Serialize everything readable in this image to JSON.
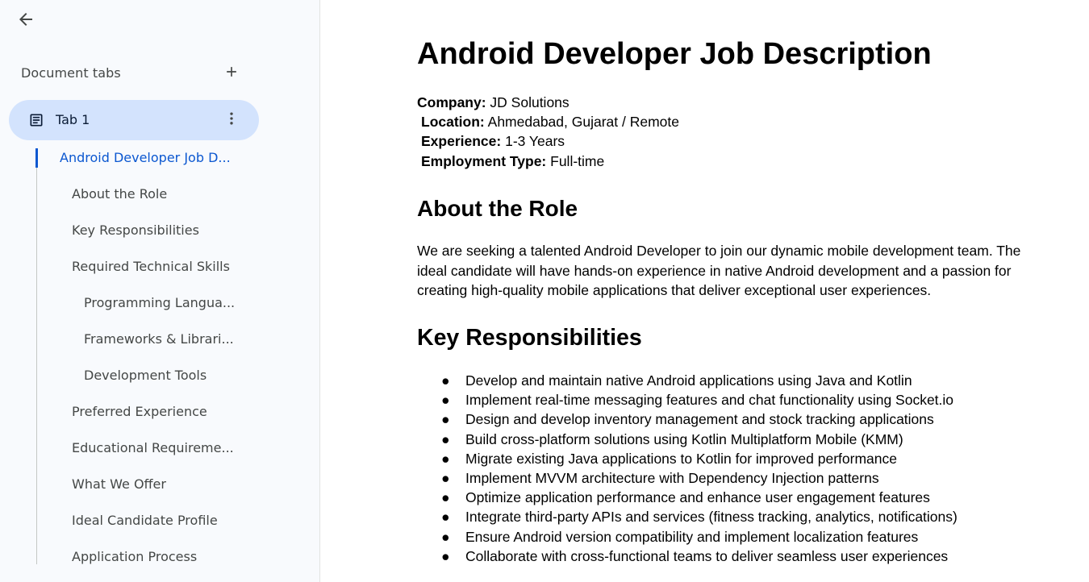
{
  "sidebar": {
    "back_icon": "arrow-left-icon",
    "tabs_title": "Document tabs",
    "add_icon": "plus-icon",
    "active_tab": {
      "label": "Tab 1",
      "icon": "document-icon",
      "more_icon": "more-vertical-icon"
    },
    "outline": [
      "Android Developer Job D...",
      "About the Role",
      "Key Responsibilities",
      "Required Technical Skills",
      "Programming Langua...",
      "Frameworks & Librari...",
      "Development Tools",
      "Preferred Experience",
      "Educational Requireme...",
      "What We Offer",
      "Ideal Candidate Profile",
      "Application Process"
    ],
    "accent_color": "#0b57d0",
    "pill_color": "#d3e3fd"
  },
  "document": {
    "title": "Android Developer Job Description",
    "meta": [
      {
        "key": "Company:",
        "value": " JD Solutions"
      },
      {
        "key": "Location:",
        "value": " Ahmedabad, Gujarat / Remote"
      },
      {
        "key": "Experience:",
        "value": " 1-3 Years"
      },
      {
        "key": "Employment Type:",
        "value": " Full-time"
      }
    ],
    "about_heading": "About the Role",
    "about_text": "We are seeking a talented Android Developer to join our dynamic mobile development team. The ideal candidate will have hands-on experience in native Android development and a passion for creating high-quality mobile applications that deliver exceptional user experiences.",
    "responsibilities_heading": "Key Responsibilities",
    "bullet": "●",
    "responsibilities": [
      "Develop and maintain native Android applications using Java and Kotlin",
      "Implement real-time messaging features and chat functionality using Socket.io",
      "Design and develop inventory management and stock tracking applications",
      "Build cross-platform solutions using Kotlin Multiplatform Mobile (KMM)",
      "Migrate existing Java applications to Kotlin for improved performance",
      "Implement MVVM architecture with Dependency Injection patterns",
      "Optimize application performance and enhance user engagement features",
      "Integrate third-party APIs and services (fitness tracking, analytics, notifications)",
      "Ensure Android version compatibility and implement localization features",
      "Collaborate with cross-functional teams to deliver seamless user experiences"
    ]
  }
}
